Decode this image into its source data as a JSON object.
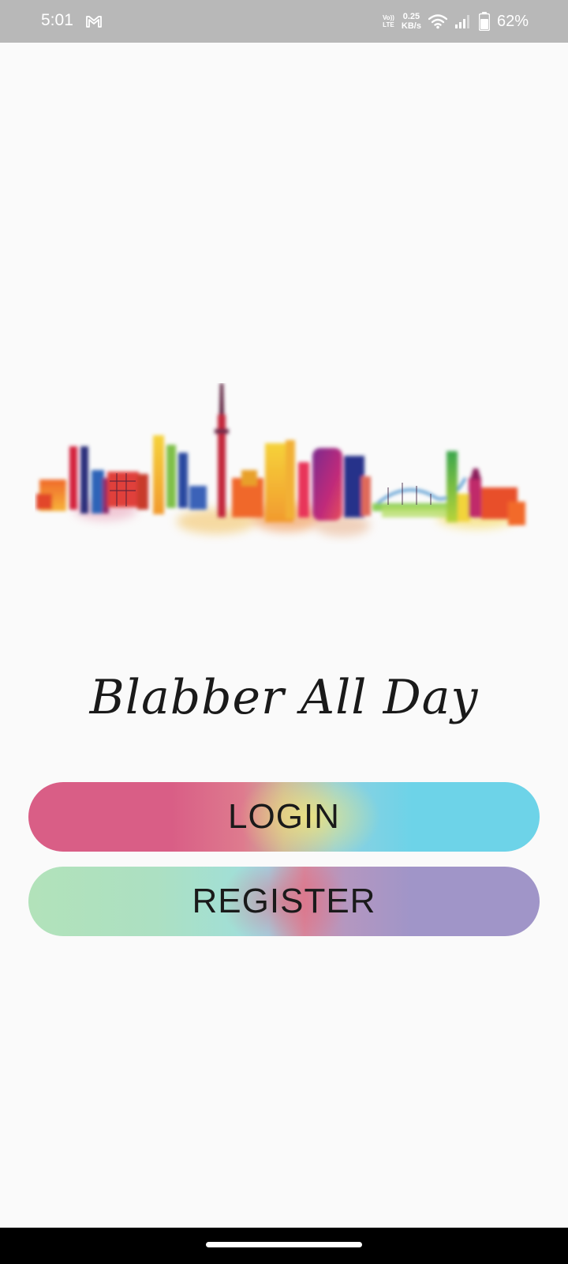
{
  "status_bar": {
    "time": "5:01",
    "notification_icon": "gmail-icon",
    "volte_line1": "Vo))",
    "volte_line2": "LTE",
    "speed_value": "0.25",
    "speed_unit": "KB/s",
    "wifi_icon": "wifi-icon",
    "signal_icon": "signal-icon",
    "battery_icon": "battery-icon",
    "battery_percent": "62%"
  },
  "hero": {
    "image_icon": "city-skyline-watercolor-illustration"
  },
  "app": {
    "title": "Blabber All Day"
  },
  "actions": {
    "login_label": "LOGIN",
    "register_label": "REGISTER"
  },
  "nav": {
    "home_indicator_icon": "home-indicator"
  },
  "colors": {
    "background": "#fafafa",
    "status_bar": "#b8b8b8",
    "login_start": "#d95e86",
    "login_end": "#6dd3e8",
    "register_start": "#b2e2ba",
    "register_end": "#a095c8",
    "text": "#1a1a1a"
  }
}
